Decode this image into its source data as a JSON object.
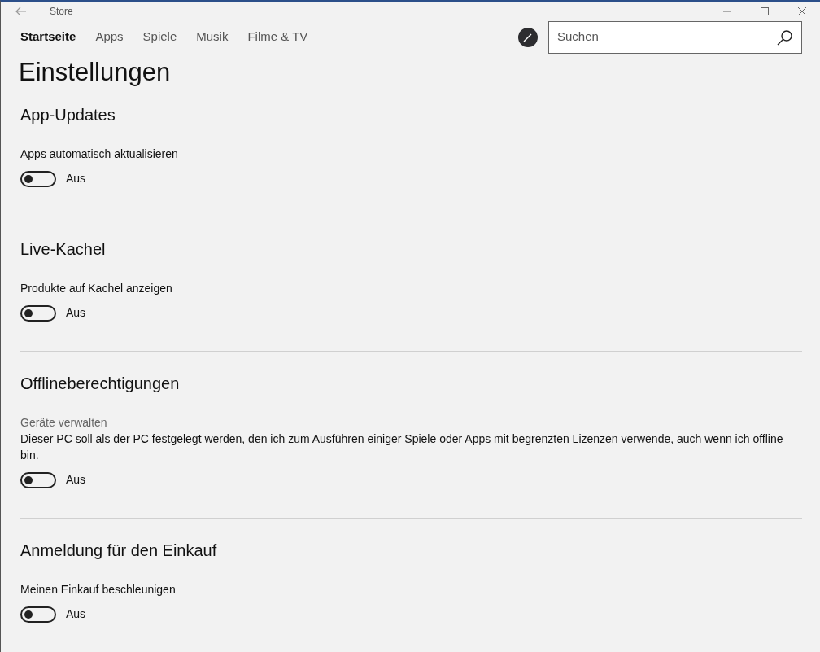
{
  "window": {
    "title": "Store"
  },
  "nav": {
    "tabs": [
      {
        "label": "Startseite",
        "selected": true
      },
      {
        "label": "Apps",
        "selected": false
      },
      {
        "label": "Spiele",
        "selected": false
      },
      {
        "label": "Musik",
        "selected": false
      },
      {
        "label": "Filme & TV",
        "selected": false
      }
    ],
    "search": {
      "placeholder": "Suchen"
    }
  },
  "page_title": "Einstellungen",
  "sections": [
    {
      "heading": "App-Updates",
      "settings": [
        {
          "label": "Apps automatisch aktualisieren",
          "on": false,
          "status": "Aus"
        }
      ]
    },
    {
      "heading": "Live-Kachel",
      "settings": [
        {
          "label": "Produkte auf Kachel anzeigen",
          "on": false,
          "status": "Aus"
        }
      ]
    },
    {
      "heading": "Offlineberechtigungen",
      "subheading": "Geräte verwalten",
      "description": "Dieser PC soll als der PC festgelegt werden, den ich zum Ausführen einiger Spiele oder Apps mit begrenzten Lizenzen verwende, auch wenn ich offline bin.",
      "settings": [
        {
          "on": false,
          "status": "Aus"
        }
      ]
    },
    {
      "heading": "Anmeldung für den Einkauf",
      "settings": [
        {
          "label": "Meinen Einkauf beschleunigen",
          "on": false,
          "status": "Aus"
        }
      ]
    }
  ]
}
